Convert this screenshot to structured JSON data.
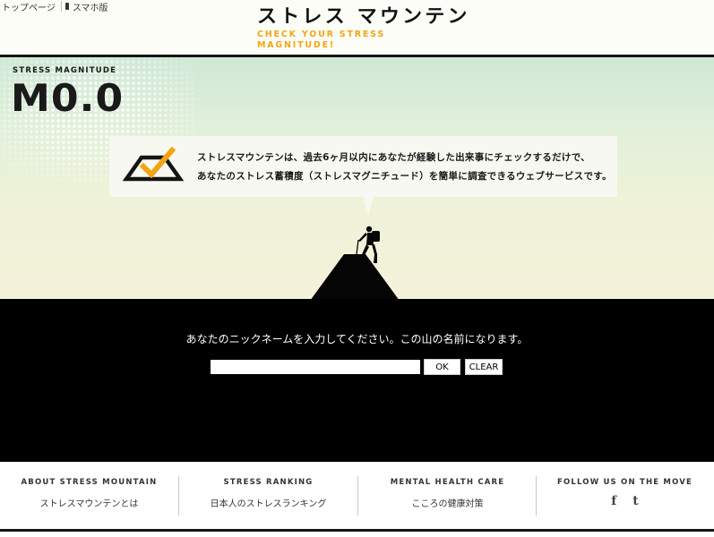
{
  "header": {
    "top_links": [
      {
        "label": "トップページ"
      },
      {
        "label": "スマホ版"
      }
    ],
    "logo_title": "ストレス マウンテン",
    "logo_subtitle": "CHECK YOUR STRESS MAGNITUDE!"
  },
  "hero": {
    "magnitude_label": "STRESS MAGNITUDE",
    "magnitude_value": "M0.0",
    "bubble_line1": "ストレスマウンテンは、過去6ヶ月以内にあなたが経験した出来事にチェックするだけで、",
    "bubble_line2": "あなたのストレス蓄積度（ストレスマグニチュード）を簡単に調査できるウェブサービスです。"
  },
  "form": {
    "prompt": "あなたのニックネームを入力してください。この山の名前になります。",
    "input_value": "",
    "ok_label": "OK",
    "clear_label": "CLEAR"
  },
  "footer": {
    "columns": [
      {
        "title": "ABOUT STRESS MOUNTAIN",
        "link": "ストレスマウンテンとは"
      },
      {
        "title": "STRESS RANKING",
        "link": "日本人のストレスランキング"
      },
      {
        "title": "MENTAL HEALTH CARE",
        "link": "こころの健康対策"
      },
      {
        "title": "FOLLOW US ON THE MOVE",
        "social": [
          "f",
          "t"
        ]
      }
    ]
  },
  "colors": {
    "accent": "#f0a612",
    "dark": "#141414",
    "band": "#000000"
  }
}
